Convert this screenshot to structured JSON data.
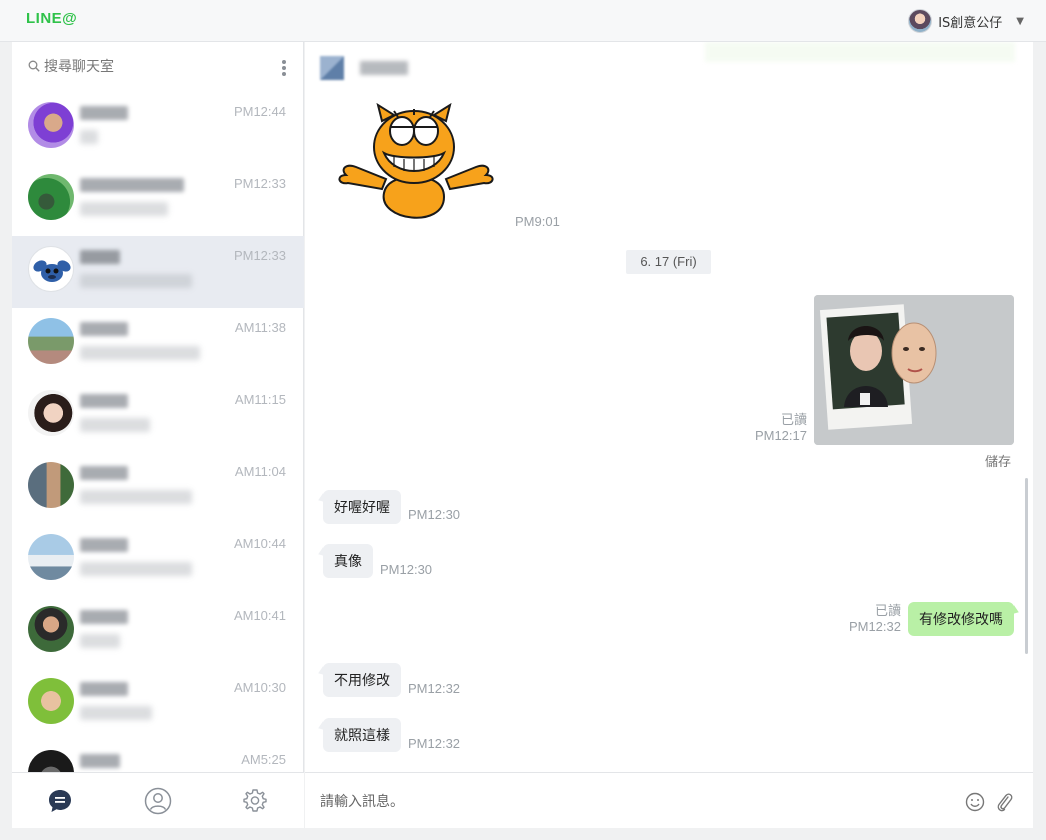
{
  "app": {
    "logo": "LINE@"
  },
  "account": {
    "name": "IS創意公仔",
    "caret": "▼"
  },
  "search": {
    "placeholder": "搜尋聊天室"
  },
  "chat_list": [
    {
      "time": "PM12:44",
      "active": false
    },
    {
      "time": "PM12:33",
      "active": false
    },
    {
      "time": "PM12:33",
      "active": true
    },
    {
      "time": "AM11:38",
      "active": false
    },
    {
      "time": "AM11:15",
      "active": false
    },
    {
      "time": "AM11:04",
      "active": false
    },
    {
      "time": "AM10:44",
      "active": false
    },
    {
      "time": "AM10:41",
      "active": false
    },
    {
      "time": "AM10:30",
      "active": false
    },
    {
      "time": "AM5:25",
      "active": false
    }
  ],
  "bottom_nav": {
    "chats_icon": "chat-bubble-icon",
    "friends_icon": "person-icon",
    "settings_icon": "gear-icon"
  },
  "conversation": {
    "sticker_time": "PM9:01",
    "date_divider": "6. 17 (Fri)",
    "photo": {
      "read": "已讀",
      "time": "PM12:17",
      "save_label": "儲存"
    },
    "messages": [
      {
        "direction": "in",
        "text": "好喔好喔",
        "time": "PM12:30"
      },
      {
        "direction": "in",
        "text": "真像",
        "time": "PM12:30"
      },
      {
        "direction": "out",
        "text": "有修改修改嗎",
        "read": "已讀",
        "time": "PM12:32"
      },
      {
        "direction": "in",
        "text": "不用修改",
        "time": "PM12:32"
      },
      {
        "direction": "in",
        "text": "就照這樣",
        "time": "PM12:32"
      }
    ]
  },
  "composer": {
    "placeholder": "請輸入訊息。",
    "emoji_icon": "smiley-icon",
    "attach_icon": "paperclip-icon"
  },
  "colors": {
    "brand": "#2fc24a",
    "outgoing_bubble": "#b9f0a6",
    "incoming_bubble": "#eef0f3",
    "active_item": "#e8ebf1"
  }
}
